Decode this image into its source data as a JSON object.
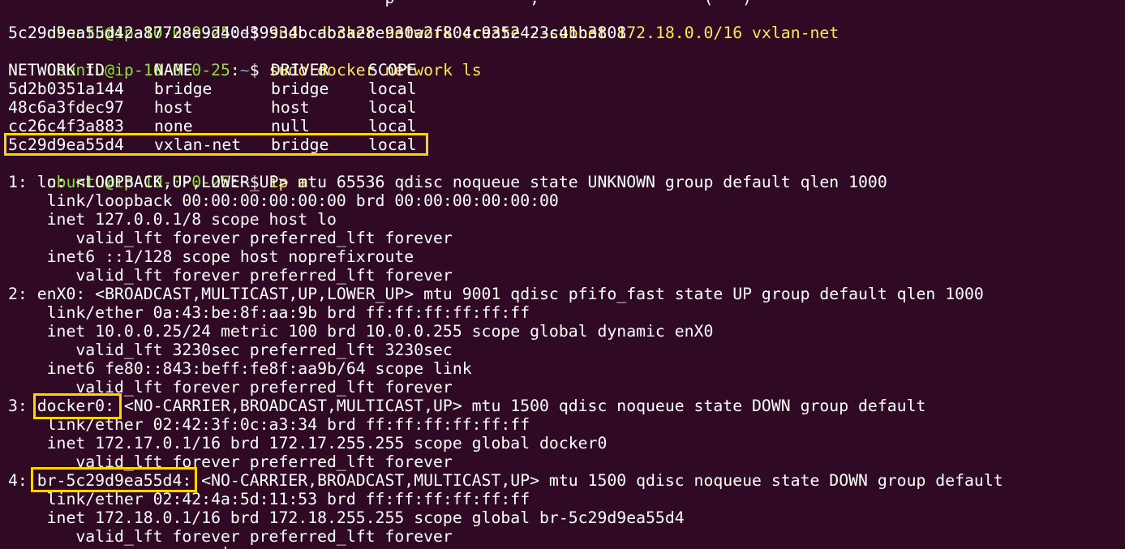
{
  "terminal": {
    "prompt": {
      "user_host": "ubuntu@ip-10-0-0-25",
      "sep": ":",
      "path": "~",
      "symbol": "$ "
    },
    "cut_top_line": "                                       p              ,                 (   )   ",
    "cmd_create": "sudo docker network create --subnet 172.18.0.0/16 vxlan-net",
    "create_output": "5c29d9ea55d42a87728e9d40d39934bcab3a28e930a2f804c9352423c41b3808",
    "cmd_ls": "sudo docker network ls",
    "ls_header": {
      "id": "NETWORK ID",
      "name": "NAME",
      "driver": "DRIVER",
      "scope": "SCOPE"
    },
    "ls_rows": [
      {
        "id": "5d2b0351a144",
        "name": "bridge",
        "driver": "bridge",
        "scope": "local"
      },
      {
        "id": "48c6a3fdec97",
        "name": "host",
        "driver": "host",
        "scope": "local"
      },
      {
        "id": "cc26c4f3a883",
        "name": "none",
        "driver": "null",
        "scope": "local"
      },
      {
        "id": "5c29d9ea55d4",
        "name": "vxlan-net",
        "driver": "bridge",
        "scope": "local"
      }
    ],
    "cmd_ip": "ip a",
    "ip_lines": [
      "1: lo: <LOOPBACK,UP,LOWER_UP> mtu 65536 qdisc noqueue state UNKNOWN group default qlen 1000",
      "    link/loopback 00:00:00:00:00:00 brd 00:00:00:00:00:00",
      "    inet 127.0.0.1/8 scope host lo",
      "       valid_lft forever preferred_lft forever",
      "    inet6 ::1/128 scope host noprefixroute",
      "       valid_lft forever preferred_lft forever",
      "2: enX0: <BROADCAST,MULTICAST,UP,LOWER_UP> mtu 9001 qdisc pfifo_fast state UP group default qlen 1000",
      "    link/ether 0a:43:be:8f:aa:9b brd ff:ff:ff:ff:ff:ff",
      "    inet 10.0.0.25/24 metric 100 brd 10.0.0.255 scope global dynamic enX0",
      "       valid_lft 3230sec preferred_lft 3230sec",
      "    inet6 fe80::843:beff:fe8f:aa9b/64 scope link",
      "       valid_lft forever preferred_lft forever",
      "3: docker0: <NO-CARRIER,BROADCAST,MULTICAST,UP> mtu 1500 qdisc noqueue state DOWN group default",
      "    link/ether 02:42:3f:0c:a3:34 brd ff:ff:ff:ff:ff:ff",
      "    inet 172.17.0.1/16 brd 172.17.255.255 scope global docker0",
      "       valid_lft forever preferred_lft forever",
      "4: br-5c29d9ea55d4: <NO-CARRIER,BROADCAST,MULTICAST,UP> mtu 1500 qdisc noqueue state DOWN group default",
      "    link/ether 02:42:4a:5d:11:53 brd ff:ff:ff:ff:ff:ff",
      "    inet 172.18.0.1/16 brd 172.18.255.255 scope global br-5c29d9ea55d4",
      "       valid_lft forever preferred_lft forever"
    ],
    "cut_bottom_line": "                      |                                                              "
  },
  "colors": {
    "background": "#300a24",
    "prompt_user": "#8ae234",
    "prompt_path": "#729fcf",
    "command": "#fce94f",
    "highlight": "#ffd400"
  }
}
